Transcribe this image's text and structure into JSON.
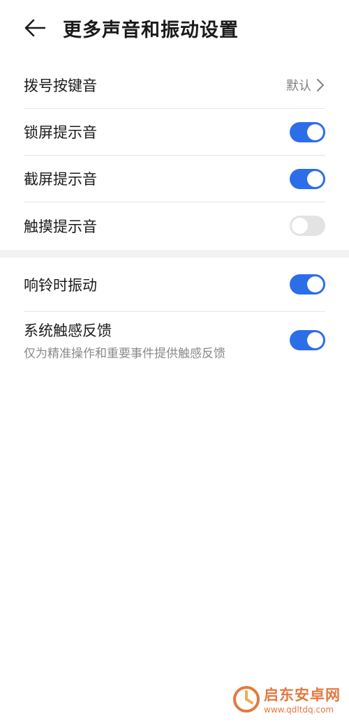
{
  "header": {
    "title": "更多声音和振动设置",
    "back_icon": "arrow-left-icon"
  },
  "group1": {
    "items": [
      {
        "label": "拨号按键音",
        "value": "默认",
        "control": "chevron"
      },
      {
        "label": "锁屏提示音",
        "toggle": "on"
      },
      {
        "label": "截屏提示音",
        "toggle": "on"
      },
      {
        "label": "触摸提示音",
        "toggle": "off"
      }
    ]
  },
  "group2": {
    "items": [
      {
        "label": "响铃时振动",
        "toggle": "on"
      },
      {
        "label": "系统触感反馈",
        "subtitle": "仅为精准操作和重要事件提供触感反馈",
        "toggle": "on"
      }
    ]
  },
  "watermark": {
    "name": "启东安卓网",
    "url": "www.qdltdq.com"
  },
  "colors": {
    "toggle_on": "#2b6ee8",
    "toggle_off": "#e3e3e3",
    "watermark": "#e0611f"
  }
}
